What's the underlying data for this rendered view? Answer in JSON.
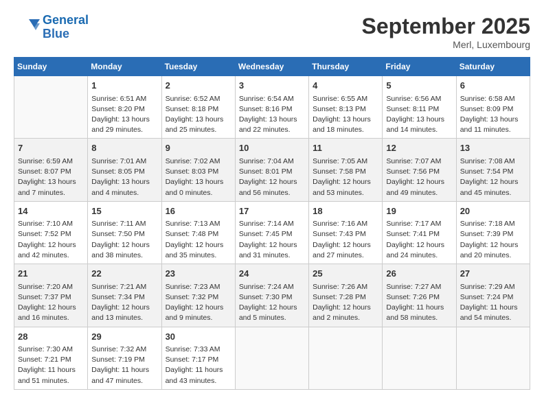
{
  "header": {
    "logo_line1": "General",
    "logo_line2": "Blue",
    "month": "September 2025",
    "location": "Merl, Luxembourg"
  },
  "days_of_week": [
    "Sunday",
    "Monday",
    "Tuesday",
    "Wednesday",
    "Thursday",
    "Friday",
    "Saturday"
  ],
  "weeks": [
    [
      {
        "day": "",
        "info": ""
      },
      {
        "day": "1",
        "info": "Sunrise: 6:51 AM\nSunset: 8:20 PM\nDaylight: 13 hours\nand 29 minutes."
      },
      {
        "day": "2",
        "info": "Sunrise: 6:52 AM\nSunset: 8:18 PM\nDaylight: 13 hours\nand 25 minutes."
      },
      {
        "day": "3",
        "info": "Sunrise: 6:54 AM\nSunset: 8:16 PM\nDaylight: 13 hours\nand 22 minutes."
      },
      {
        "day": "4",
        "info": "Sunrise: 6:55 AM\nSunset: 8:13 PM\nDaylight: 13 hours\nand 18 minutes."
      },
      {
        "day": "5",
        "info": "Sunrise: 6:56 AM\nSunset: 8:11 PM\nDaylight: 13 hours\nand 14 minutes."
      },
      {
        "day": "6",
        "info": "Sunrise: 6:58 AM\nSunset: 8:09 PM\nDaylight: 13 hours\nand 11 minutes."
      }
    ],
    [
      {
        "day": "7",
        "info": "Sunrise: 6:59 AM\nSunset: 8:07 PM\nDaylight: 13 hours\nand 7 minutes."
      },
      {
        "day": "8",
        "info": "Sunrise: 7:01 AM\nSunset: 8:05 PM\nDaylight: 13 hours\nand 4 minutes."
      },
      {
        "day": "9",
        "info": "Sunrise: 7:02 AM\nSunset: 8:03 PM\nDaylight: 13 hours\nand 0 minutes."
      },
      {
        "day": "10",
        "info": "Sunrise: 7:04 AM\nSunset: 8:01 PM\nDaylight: 12 hours\nand 56 minutes."
      },
      {
        "day": "11",
        "info": "Sunrise: 7:05 AM\nSunset: 7:58 PM\nDaylight: 12 hours\nand 53 minutes."
      },
      {
        "day": "12",
        "info": "Sunrise: 7:07 AM\nSunset: 7:56 PM\nDaylight: 12 hours\nand 49 minutes."
      },
      {
        "day": "13",
        "info": "Sunrise: 7:08 AM\nSunset: 7:54 PM\nDaylight: 12 hours\nand 45 minutes."
      }
    ],
    [
      {
        "day": "14",
        "info": "Sunrise: 7:10 AM\nSunset: 7:52 PM\nDaylight: 12 hours\nand 42 minutes."
      },
      {
        "day": "15",
        "info": "Sunrise: 7:11 AM\nSunset: 7:50 PM\nDaylight: 12 hours\nand 38 minutes."
      },
      {
        "day": "16",
        "info": "Sunrise: 7:13 AM\nSunset: 7:48 PM\nDaylight: 12 hours\nand 35 minutes."
      },
      {
        "day": "17",
        "info": "Sunrise: 7:14 AM\nSunset: 7:45 PM\nDaylight: 12 hours\nand 31 minutes."
      },
      {
        "day": "18",
        "info": "Sunrise: 7:16 AM\nSunset: 7:43 PM\nDaylight: 12 hours\nand 27 minutes."
      },
      {
        "day": "19",
        "info": "Sunrise: 7:17 AM\nSunset: 7:41 PM\nDaylight: 12 hours\nand 24 minutes."
      },
      {
        "day": "20",
        "info": "Sunrise: 7:18 AM\nSunset: 7:39 PM\nDaylight: 12 hours\nand 20 minutes."
      }
    ],
    [
      {
        "day": "21",
        "info": "Sunrise: 7:20 AM\nSunset: 7:37 PM\nDaylight: 12 hours\nand 16 minutes."
      },
      {
        "day": "22",
        "info": "Sunrise: 7:21 AM\nSunset: 7:34 PM\nDaylight: 12 hours\nand 13 minutes."
      },
      {
        "day": "23",
        "info": "Sunrise: 7:23 AM\nSunset: 7:32 PM\nDaylight: 12 hours\nand 9 minutes."
      },
      {
        "day": "24",
        "info": "Sunrise: 7:24 AM\nSunset: 7:30 PM\nDaylight: 12 hours\nand 5 minutes."
      },
      {
        "day": "25",
        "info": "Sunrise: 7:26 AM\nSunset: 7:28 PM\nDaylight: 12 hours\nand 2 minutes."
      },
      {
        "day": "26",
        "info": "Sunrise: 7:27 AM\nSunset: 7:26 PM\nDaylight: 11 hours\nand 58 minutes."
      },
      {
        "day": "27",
        "info": "Sunrise: 7:29 AM\nSunset: 7:24 PM\nDaylight: 11 hours\nand 54 minutes."
      }
    ],
    [
      {
        "day": "28",
        "info": "Sunrise: 7:30 AM\nSunset: 7:21 PM\nDaylight: 11 hours\nand 51 minutes."
      },
      {
        "day": "29",
        "info": "Sunrise: 7:32 AM\nSunset: 7:19 PM\nDaylight: 11 hours\nand 47 minutes."
      },
      {
        "day": "30",
        "info": "Sunrise: 7:33 AM\nSunset: 7:17 PM\nDaylight: 11 hours\nand 43 minutes."
      },
      {
        "day": "",
        "info": ""
      },
      {
        "day": "",
        "info": ""
      },
      {
        "day": "",
        "info": ""
      },
      {
        "day": "",
        "info": ""
      }
    ]
  ]
}
